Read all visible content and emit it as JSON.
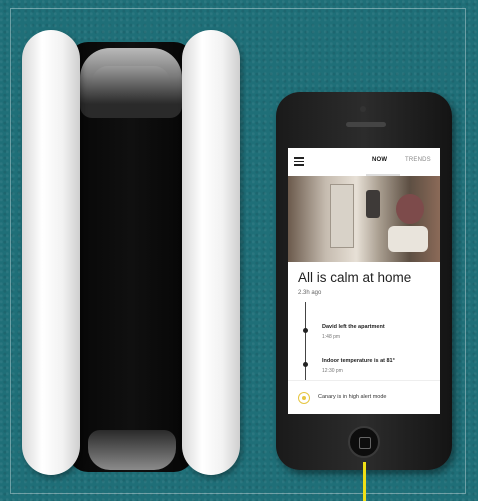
{
  "app": {
    "tabs": [
      "NOW",
      "TRENDS"
    ],
    "headline": "All is calm at home",
    "time_ago": "2.3h ago",
    "events": [
      {
        "title": "David left the apartment",
        "time": "1:48 pm"
      },
      {
        "title": "Indoor temperature is at 81°",
        "time": "12:30 pm"
      }
    ],
    "mode_text": "Canary is in high alert mode"
  },
  "colors": {
    "background": "#1f6f78",
    "accent_yellow": "#f0e016"
  }
}
